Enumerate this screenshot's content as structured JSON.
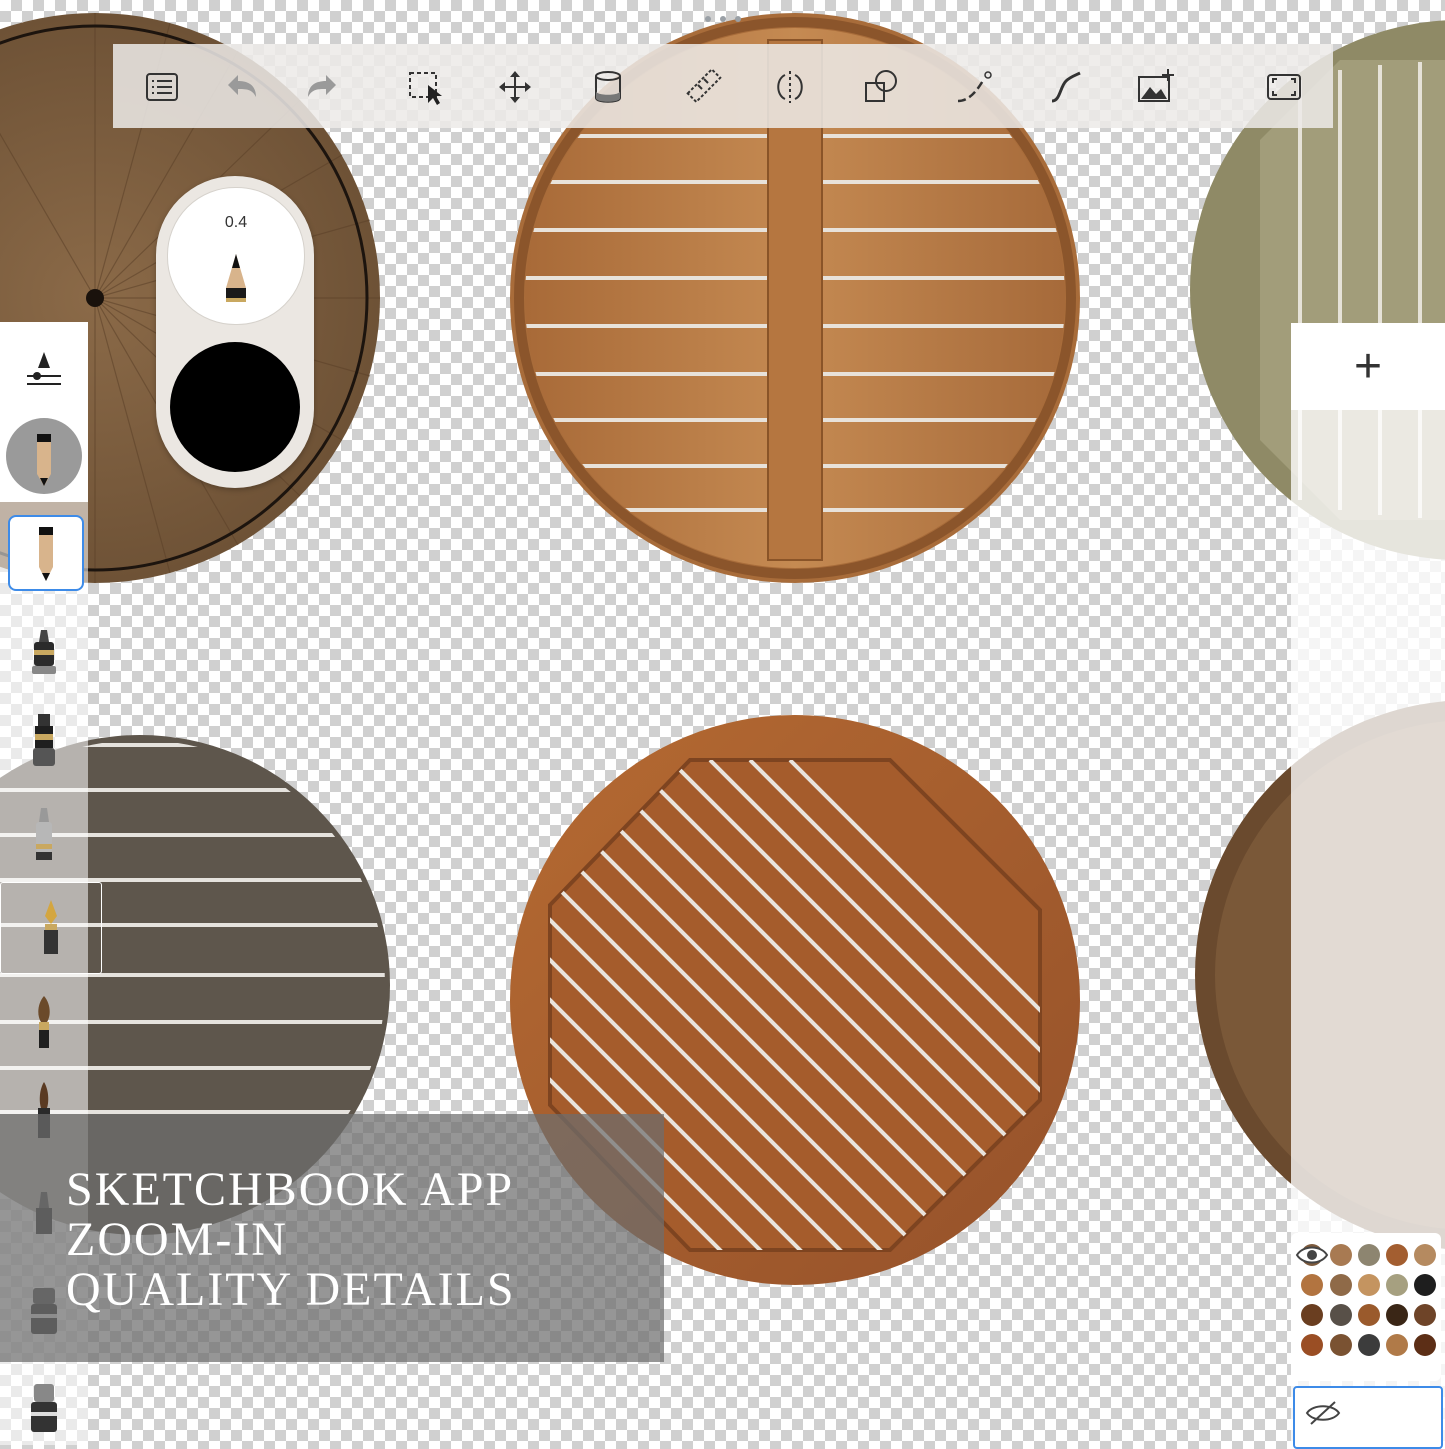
{
  "app": {
    "name": "Sketchbook",
    "brush_size_value": "0.4",
    "current_color": "#000000",
    "selected_brush": "pencil"
  },
  "toolbar": {
    "tools": [
      {
        "id": "menu",
        "icon": "list-icon"
      },
      {
        "id": "undo",
        "icon": "undo-icon"
      },
      {
        "id": "redo",
        "icon": "redo-icon"
      },
      {
        "id": "select",
        "icon": "selection-icon"
      },
      {
        "id": "transform",
        "icon": "move-icon"
      },
      {
        "id": "fill",
        "icon": "bucket-icon"
      },
      {
        "id": "ruler",
        "icon": "ruler-icon"
      },
      {
        "id": "symmetry",
        "icon": "symmetry-icon"
      },
      {
        "id": "shapes",
        "icon": "shapes-icon"
      },
      {
        "id": "stroke",
        "icon": "curve-stroke-icon"
      },
      {
        "id": "steady",
        "icon": "predictive-stroke-icon"
      },
      {
        "id": "add-image",
        "icon": "add-image-icon"
      },
      {
        "id": "fullscreen",
        "icon": "fullscreen-icon"
      }
    ]
  },
  "right_panel": {
    "add_layer_label": "+"
  },
  "caption": {
    "line1": "SKETCHBOOK APP",
    "line2": "ZOOM-IN",
    "line3": "QUALITY DETAILS"
  },
  "colors": {
    "accent": "#3d8be8",
    "wood_light": "#b87a45",
    "wood_dark": "#5d5448",
    "wood_orange": "#a85c2c",
    "wood_walnut": "#6a4a2e",
    "wood_oak_green": "#8e8a68"
  }
}
